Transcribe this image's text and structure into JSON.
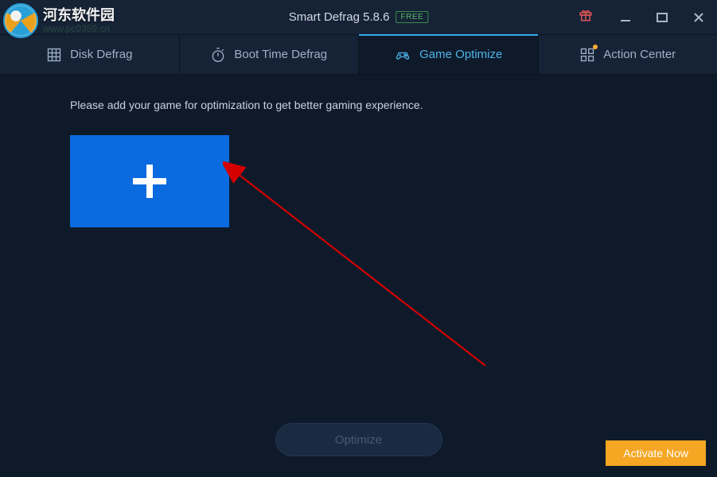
{
  "title": {
    "app_name": "Smart Defrag 5.8.6",
    "badge": "FREE"
  },
  "tabs": {
    "t0": {
      "label": "Disk Defrag"
    },
    "t1": {
      "label": "Boot Time Defrag"
    },
    "t2": {
      "label": "Game Optimize"
    },
    "t3": {
      "label": "Action Center"
    }
  },
  "content": {
    "instruction": "Please add your game for optimization to get better gaming experience."
  },
  "buttons": {
    "optimize": "Optimize",
    "activate": "Activate Now"
  },
  "watermark": {
    "cn": "河东软件园",
    "url": "www.pc0359.cn"
  }
}
